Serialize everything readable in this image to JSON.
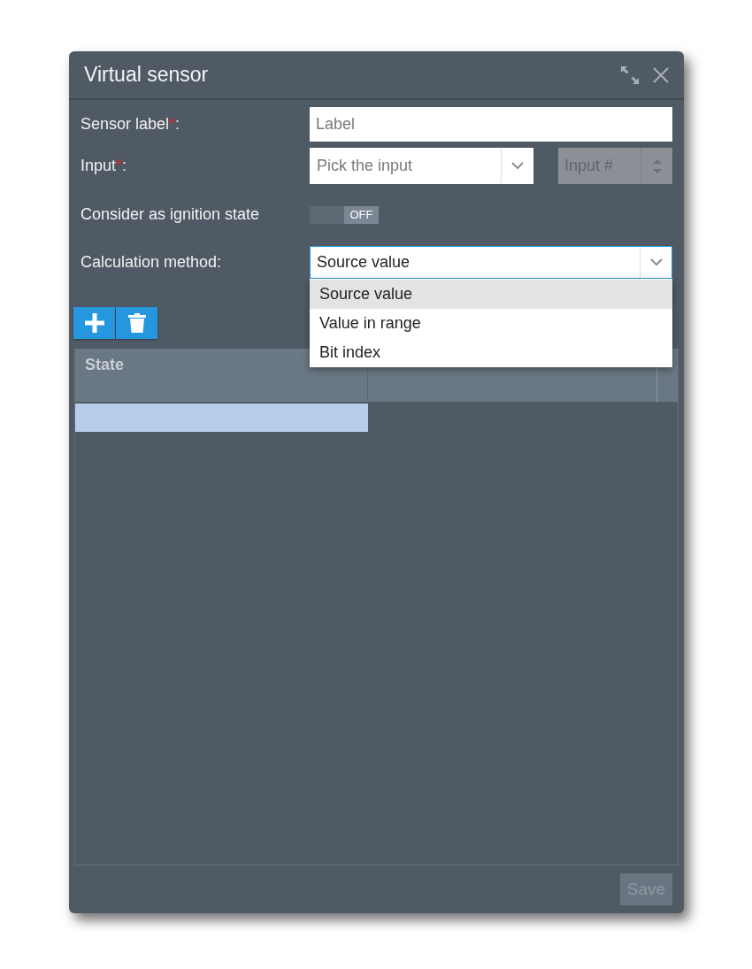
{
  "window": {
    "title": "Virtual sensor"
  },
  "fields": [
    {
      "kind": "text",
      "label": "Sensor label",
      "required_mark": "*",
      "after": ":",
      "placeholder": "Label"
    },
    {
      "kind": "select_number",
      "label": "Input",
      "required_mark": "*",
      "after": ":",
      "placeholder": "Pick the input",
      "number_placeholder": "Input #",
      "number_disabled": true
    },
    {
      "kind": "toggle",
      "label": "Consider as ignition state",
      "on": false,
      "text": "OFF"
    },
    {
      "kind": "select",
      "label": "Calculation method:",
      "value": "Source value",
      "expanded": true,
      "options": [
        {
          "label": "Source value",
          "selected": true
        },
        {
          "label": "Value in range",
          "selected": false
        },
        {
          "label": "Bit index",
          "selected": false
        }
      ]
    }
  ],
  "toolbar": [
    {
      "kind": "add"
    },
    {
      "kind": "delete"
    }
  ],
  "table": {
    "columns": [
      "State"
    ],
    "rows": [
      {
        "selected": true
      }
    ]
  },
  "save_button": {
    "label": "Save",
    "disabled": true
  }
}
